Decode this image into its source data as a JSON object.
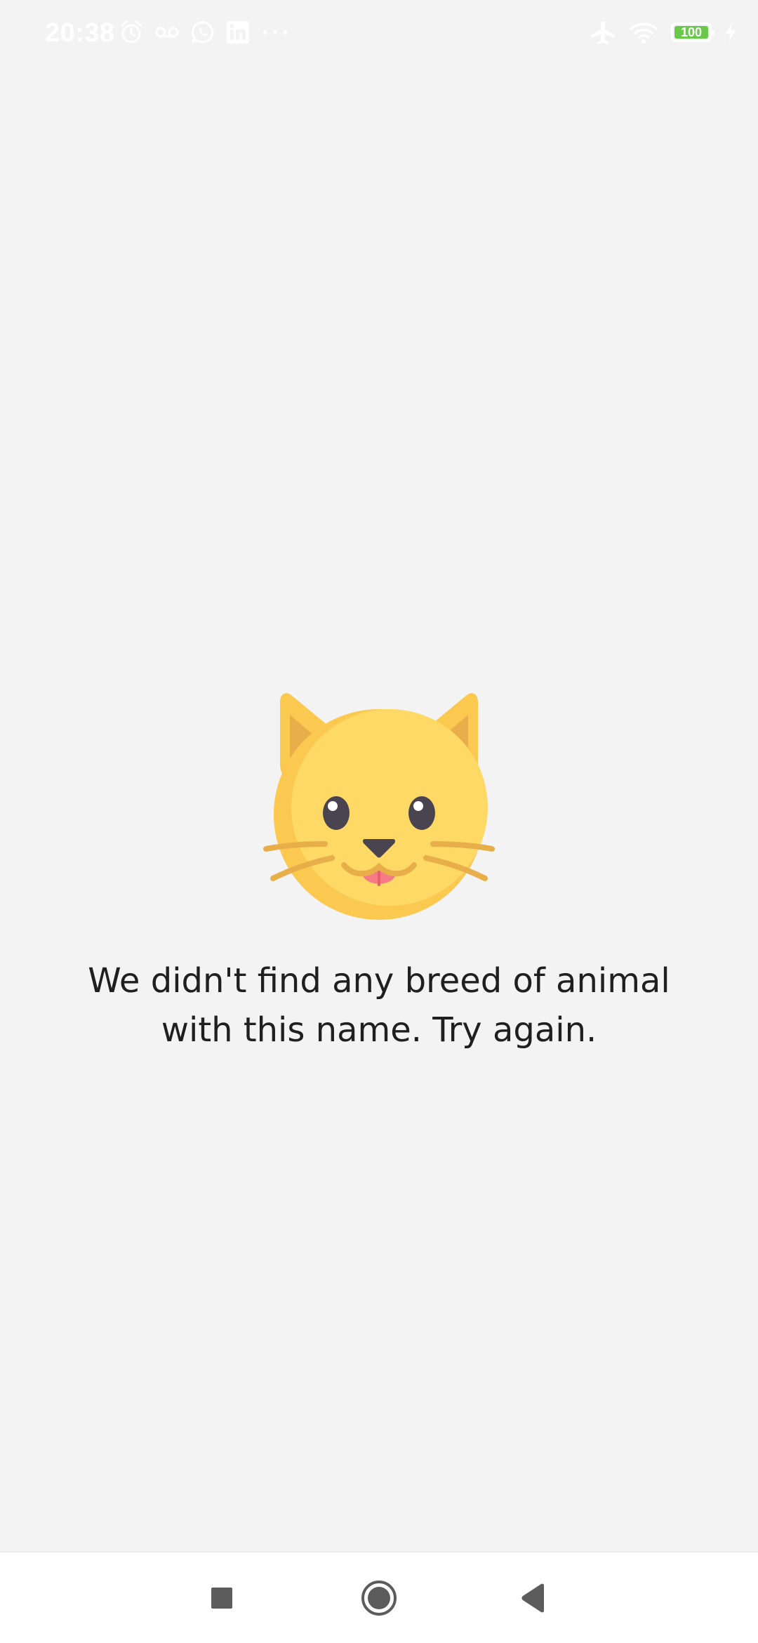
{
  "status_bar": {
    "time": "20:38",
    "left_icons": [
      "alarm-icon",
      "voicemail-icon",
      "whatsapp-icon",
      "linkedin-icon",
      "more-dots-icon"
    ],
    "right_icons": [
      "airplane-mode-icon",
      "wifi-icon",
      "battery-icon",
      "charging-bolt-icon"
    ],
    "battery_level": "100",
    "battery_fraction": 1.0,
    "battery_color": "#6ac94a"
  },
  "empty_state": {
    "illustration": "cat-face-icon",
    "message": "We didn't find any breed of animal with this name. Try again."
  },
  "navigation_bar": {
    "buttons": [
      "recent-apps-button",
      "home-button",
      "back-button"
    ]
  },
  "colors": {
    "background": "#f3f3f3",
    "nav_background": "#ffffff",
    "cat_primary": "#ffd966",
    "cat_shadow": "#fbc850",
    "cat_accent": "#e8ae4a"
  }
}
